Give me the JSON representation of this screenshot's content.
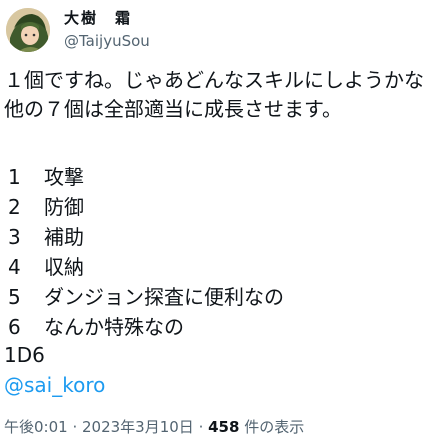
{
  "user": {
    "display_name": "大樹　霜",
    "handle": "@TaijyuSou"
  },
  "tweet": {
    "line1": "１個ですね。じゃあどんなスキルにしようかな",
    "line2": "他の７個は全部適当に成長させます。",
    "skills": [
      {
        "num": "1",
        "label": "攻撃"
      },
      {
        "num": "2",
        "label": "防御"
      },
      {
        "num": "3",
        "label": "補助"
      },
      {
        "num": "4",
        "label": "収納"
      },
      {
        "num": "5",
        "label": "ダンジョン探査に便利なの"
      },
      {
        "num": "6",
        "label": "なんか特殊なの"
      }
    ],
    "dice": "1D6",
    "mention": "@sai_koro"
  },
  "meta": {
    "time": "午後0:01",
    "sep1": " · ",
    "date": "2023年3月10日",
    "sep2": " · ",
    "views_count": "458",
    "views_label": " 件の表示"
  }
}
